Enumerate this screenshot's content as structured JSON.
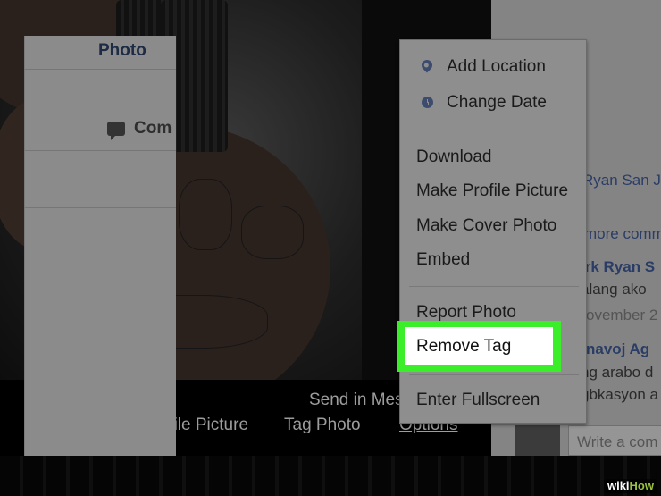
{
  "viewer": {
    "send_in": "Send in Mes",
    "actions": {
      "make_profile": "Make Profile Picture",
      "tag_photo": "Tag Photo",
      "options": "Options"
    }
  },
  "side": {
    "tab": "Photo",
    "comments_label": "Com",
    "tagged": "Ryan San J",
    "more_comments": "more comm",
    "commenter_1": "irk Ryan S",
    "comment_1": "alang ako",
    "date_1": "ovember 2",
    "commenter_2": "navoj Ag",
    "comment_2a": "ng arabo d",
    "comment_2b": "gbkasyon a",
    "write_placeholder": "Write a com"
  },
  "menu": {
    "add_location": "Add Location",
    "change_date": "Change Date",
    "download": "Download",
    "make_profile": "Make Profile Picture",
    "make_cover": "Make Cover Photo",
    "embed": "Embed",
    "report": "Report Photo",
    "remove_tag": "Remove Tag",
    "fullscreen": "Enter Fullscreen"
  },
  "watermark": {
    "a": "wiki",
    "b": "How"
  },
  "colors": {
    "highlight": "#3aef2a",
    "link": "#2b3d66"
  }
}
